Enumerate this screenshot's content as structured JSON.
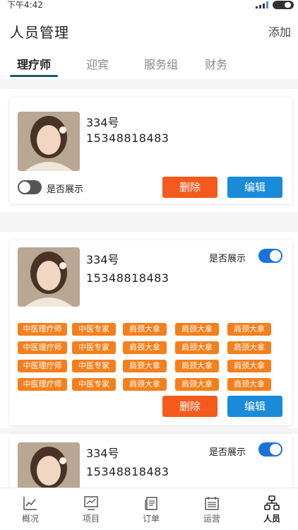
{
  "status": {
    "time": "下午4:42"
  },
  "header": {
    "title": "人员管理",
    "add_label": "添加"
  },
  "tabs": [
    {
      "label": "理疗师",
      "active": true
    },
    {
      "label": "迎宾",
      "active": false
    },
    {
      "label": "服务组",
      "active": false
    },
    {
      "label": "财务",
      "active": false
    }
  ],
  "cards": [
    {
      "name": "334号",
      "phone": "15348818483",
      "show_label": "是否展示",
      "show_enabled": false,
      "delete_label": "删除",
      "edit_label": "编辑"
    },
    {
      "name": "334号",
      "phone": "15348818483",
      "show_label": "是否展示",
      "show_enabled": true,
      "delete_label": "删除",
      "edit_label": "编辑",
      "tags": [
        [
          "中医理疗师",
          "中医专家",
          "肩颈大拿",
          "肩颈大拿",
          "肩颈大拿"
        ],
        [
          "中医理疗师",
          "中医专家",
          "肩颈大拿",
          "肩颈大拿",
          "肩颈大拿"
        ],
        [
          "中医理疗师",
          "中医专家",
          "肩颈大拿",
          "肩颈大拿",
          "肩颈大拿"
        ],
        [
          "中医理疗师",
          "中医专家",
          "肩颈大拿",
          "肩颈大拿",
          "肩颈大拿"
        ]
      ]
    },
    {
      "name": "334号",
      "phone": "15348818483",
      "show_label": "是否展示",
      "show_enabled": true
    }
  ],
  "bottom_nav": [
    {
      "label": "概况",
      "icon": "chart-line-icon",
      "active": false
    },
    {
      "label": "项目",
      "icon": "monitor-chart-icon",
      "active": false
    },
    {
      "label": "订单",
      "icon": "document-stack-icon",
      "active": false
    },
    {
      "label": "运营",
      "icon": "calendar-list-icon",
      "active": false
    },
    {
      "label": "人员",
      "icon": "org-chart-icon",
      "active": true
    }
  ],
  "colors": {
    "accent": "#1d5a66",
    "delete": "#f35a1c",
    "edit": "#1a8ad9",
    "tag": "#f47f1c",
    "toggle_on": "#1a73d9"
  }
}
